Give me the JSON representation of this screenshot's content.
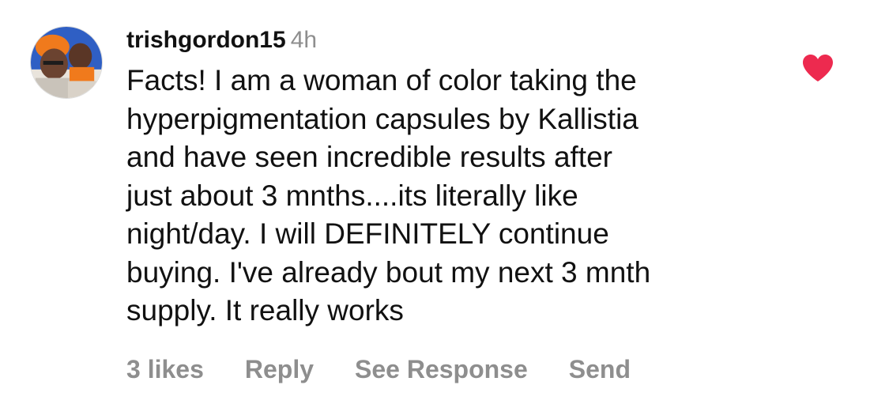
{
  "comment": {
    "username": "trishgordon15",
    "time": "4h",
    "text_lines": [
      "Facts! I am a woman of color taking the",
      "hyperpigmentation capsules by Kallistia",
      "and have seen incredible results after",
      "just about 3 mnths....its literally like",
      "night/day. I will DEFINITELY continue",
      "buying. I've already bout my next 3 mnth",
      "supply. It really works"
    ],
    "liked": true,
    "like_icon": "heart-filled-icon"
  },
  "actions": {
    "likes": "3 likes",
    "reply": "Reply",
    "see_response": "See Response",
    "send": "Send"
  },
  "colors": {
    "heart": "#ed2a4f",
    "secondary_text": "#8e8e8e",
    "primary_text": "#111111",
    "background": "#ffffff"
  }
}
